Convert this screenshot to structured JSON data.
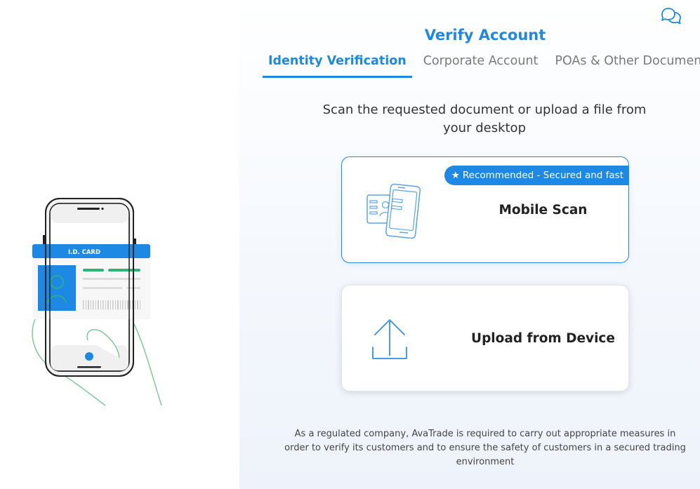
{
  "header": {
    "title": "Verify Account",
    "chat_icon": "chat-bubbles-icon"
  },
  "tabs": [
    {
      "label": "Identity Verification",
      "active": true
    },
    {
      "label": "Corporate Account",
      "active": false
    },
    {
      "label": "POAs & Other Document",
      "active": false
    }
  ],
  "main": {
    "instructions": "Scan the requested document or upload a file from your desktop",
    "options": [
      {
        "label": "Mobile Scan",
        "badge": "Recommended - Secured and fast",
        "icon": "id-card-phone-icon",
        "selected": true
      },
      {
        "label": "Upload from Device",
        "icon": "upload-icon",
        "selected": false
      }
    ],
    "footer_note": "As a regulated company, AvaTrade is required to carry out appropriate measures in order to verify its customers and to ensure the safety of customers in a secured trading environment"
  },
  "illustration": {
    "card_header": "I.D. CARD",
    "icon": "phone-scanning-id-card-icon"
  },
  "colors": {
    "accent": "#1e88e5",
    "green": "#2bb673",
    "text": "#333333"
  }
}
